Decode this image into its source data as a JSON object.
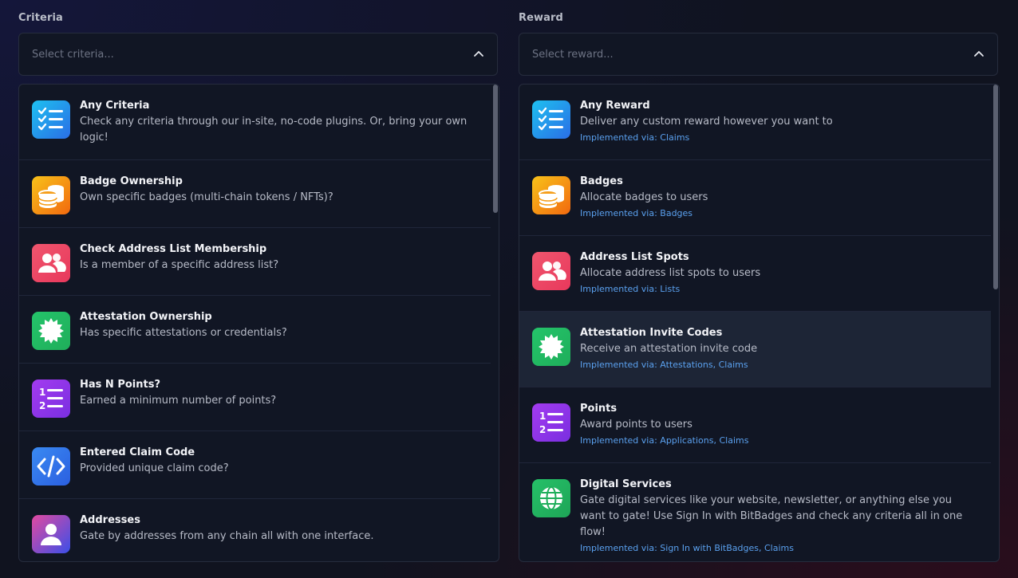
{
  "criteria": {
    "title": "Criteria",
    "placeholder": "Select criteria...",
    "items": [
      {
        "title": "Any Criteria",
        "desc": "Check any criteria through our in-site, no-code plugins. Or, bring your own logic!",
        "icon": "checklist-icon"
      },
      {
        "title": "Badge Ownership",
        "desc": "Own specific badges (multi-chain tokens / NFTs)?",
        "icon": "coins-icon"
      },
      {
        "title": "Check Address List Membership",
        "desc": "Is a member of a specific address list?",
        "icon": "users-icon"
      },
      {
        "title": "Attestation Ownership",
        "desc": "Has specific attestations or credentials?",
        "icon": "badge-seal-icon"
      },
      {
        "title": "Has N Points?",
        "desc": "Earned a minimum number of points?",
        "icon": "numbered-list-icon"
      },
      {
        "title": "Entered Claim Code",
        "desc": "Provided unique claim code?",
        "icon": "code-icon"
      },
      {
        "title": "Addresses",
        "desc": "Gate by addresses from any chain all with one interface.",
        "icon": "user-icon"
      }
    ]
  },
  "reward": {
    "title": "Reward",
    "placeholder": "Select reward...",
    "items": [
      {
        "title": "Any Reward",
        "desc": "Deliver any custom reward however you want to",
        "via": "Implemented via: Claims",
        "icon": "checklist-icon"
      },
      {
        "title": "Badges",
        "desc": "Allocate badges to users",
        "via": "Implemented via: Badges",
        "icon": "coins-icon"
      },
      {
        "title": "Address List Spots",
        "desc": "Allocate address list spots to users",
        "via": "Implemented via: Lists",
        "icon": "users-icon"
      },
      {
        "title": "Attestation Invite Codes",
        "desc": "Receive an attestation invite code",
        "via": "Implemented via: Attestations, Claims",
        "icon": "badge-seal-icon"
      },
      {
        "title": "Points",
        "desc": "Award points to users",
        "via": "Implemented via: Applications, Claims",
        "icon": "numbered-list-icon"
      },
      {
        "title": "Digital Services",
        "desc": "Gate digital services like your website, newsletter, or anything else you want to gate! Use Sign In with BitBadges and check any criteria all in one flow!",
        "via": "Implemented via: Sign In with BitBadges, Claims",
        "icon": "globe-icon"
      }
    ]
  },
  "colors": {
    "checklist": [
      "#1ec0f0",
      "#2a6ee6"
    ],
    "coins": [
      "#f8c21a",
      "#f2690f"
    ],
    "users": [
      "#f0566e",
      "#e8385c"
    ],
    "seal": [
      "#24c46a",
      "#1fae5a"
    ],
    "numbered": [
      "#a33bf0",
      "#7a2fe0"
    ],
    "code": [
      "#3a8af2",
      "#2b5fe0"
    ],
    "user": [
      "#e24aa0",
      "#3b4fe8"
    ],
    "globe": [
      "#26c068",
      "#1ea557"
    ]
  }
}
